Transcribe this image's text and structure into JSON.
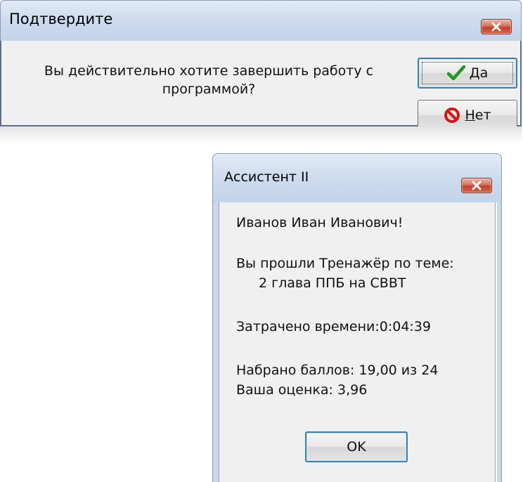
{
  "confirm_dialog": {
    "title": "Подтвердите",
    "message_line1": "Вы действительно хотите завершить работу с",
    "message_line2": "программой?",
    "yes_accel": "Д",
    "yes_rest": "а",
    "no_accel": "Н",
    "no_rest": "ет",
    "icons": {
      "close": "close-icon",
      "yes": "checkmark-icon",
      "no": "prohibited-icon"
    }
  },
  "assistant_dialog": {
    "title": "Ассистент II",
    "greeting": "Иванов Иван Иванович!",
    "passed_line": "Вы прошли Тренажёр по теме:",
    "topic": "2 глава ППБ на СВВТ",
    "time_spent": "Затрачено времени:0:04:39",
    "score": "Набрано баллов: 19,00 из 24",
    "grade": "Ваша оценка: 3,96",
    "ok_label": "OK",
    "icons": {
      "close": "close-icon"
    }
  },
  "colors": {
    "titlebar": "#cfdcee",
    "close_button": "#c2412a",
    "dialog_face": "#f0f0f0",
    "default_button_border": "#3c7fb1",
    "checkmark": "#1e9a1e",
    "prohibited": "#d01818"
  }
}
